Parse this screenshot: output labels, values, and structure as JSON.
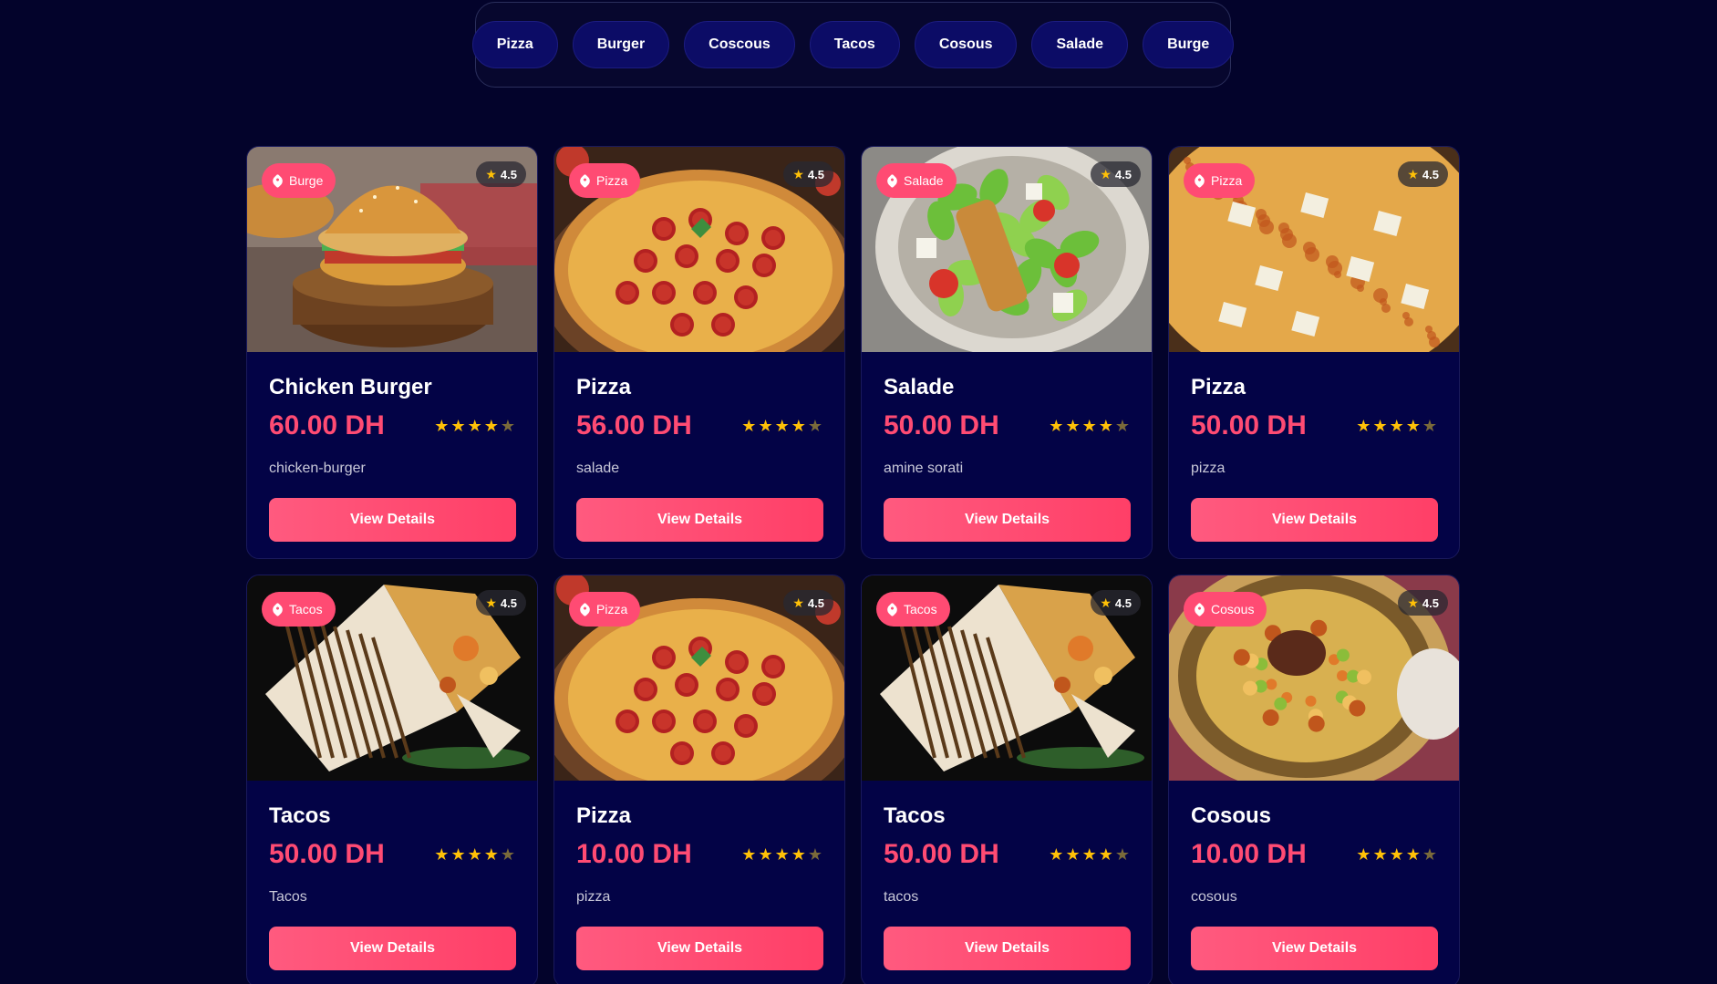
{
  "categories": [
    "Pizza",
    "Burger",
    "Coscous",
    "Tacos",
    "Cosous",
    "Salade",
    "Burge"
  ],
  "products": [
    {
      "title": "Chicken Burger",
      "price": "60.00 DH",
      "category": "Burge",
      "rating": "4.5",
      "description": "chicken-burger",
      "button": "View Details",
      "image": "burger"
    },
    {
      "title": "Pizza",
      "price": "56.00 DH",
      "category": "Pizza",
      "rating": "4.5",
      "description": "salade",
      "button": "View Details",
      "image": "pepperoni-pizza"
    },
    {
      "title": "Salade",
      "price": "50.00 DH",
      "category": "Salade",
      "rating": "4.5",
      "description": "amine sorati",
      "button": "View Details",
      "image": "salad"
    },
    {
      "title": "Pizza",
      "price": "50.00 DH",
      "category": "Pizza",
      "rating": "4.5",
      "description": "pizza",
      "button": "View Details",
      "image": "cheese-pizza"
    },
    {
      "title": "Tacos",
      "price": "50.00 DH",
      "category": "Tacos",
      "rating": "4.5",
      "description": "Tacos",
      "button": "View Details",
      "image": "tacos"
    },
    {
      "title": "Pizza",
      "price": "10.00 DH",
      "category": "Pizza",
      "rating": "4.5",
      "description": "pizza",
      "button": "View Details",
      "image": "pepperoni-pizza"
    },
    {
      "title": "Tacos",
      "price": "50.00 DH",
      "category": "Tacos",
      "rating": "4.5",
      "description": "tacos",
      "button": "View Details",
      "image": "tacos"
    },
    {
      "title": "Cosous",
      "price": "10.00 DH",
      "category": "Cosous",
      "rating": "4.5",
      "description": "cosous",
      "button": "View Details",
      "image": "couscous"
    }
  ],
  "stars_filled": 4,
  "stars_total": 5,
  "colors": {
    "background": "#03032b",
    "card": "#030346",
    "accent": "#ff4b73",
    "star": "#ffc107",
    "pill": "#0c0c66"
  }
}
